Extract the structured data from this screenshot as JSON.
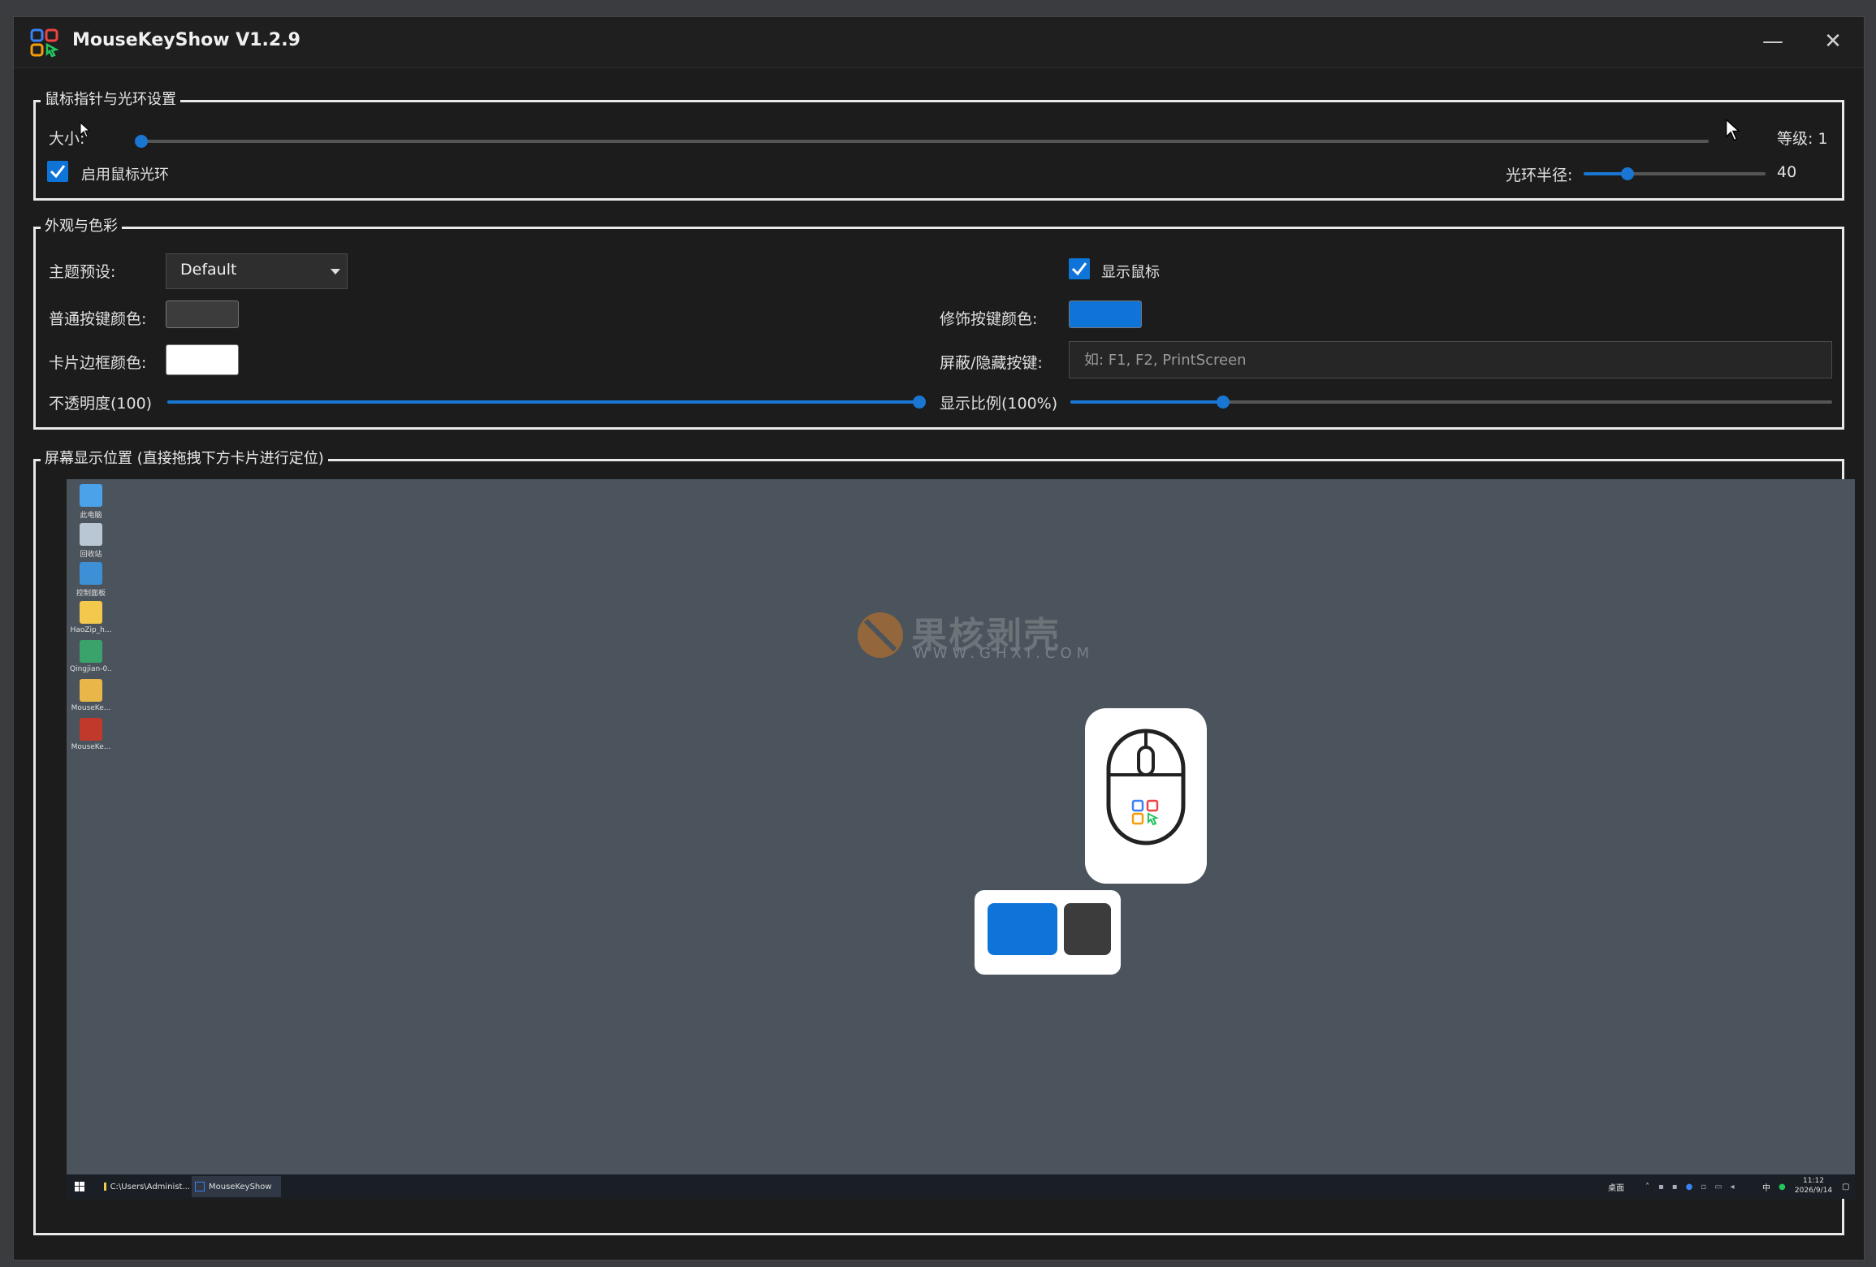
{
  "window": {
    "title": "MouseKeyShow V1.2.9",
    "minimize_glyph": "—",
    "close_glyph": "✕"
  },
  "pointer_group": {
    "title": "鼠标指针与光环设置",
    "size_label": "大小:",
    "size_fraction": 0.0,
    "level_label": "等级: 1",
    "enable_halo_label": "启用鼠标光环",
    "enable_halo_checked": true,
    "halo_radius_label": "光环半径:",
    "halo_radius_value": "40",
    "halo_radius_fraction": 0.24
  },
  "appearance_group": {
    "title": "外观与色彩",
    "theme_label": "主题预设:",
    "theme_value": "Default",
    "show_mouse_label": "显示鼠标",
    "show_mouse_checked": true,
    "normal_key_color_label": "普通按键颜色:",
    "normal_key_color": "#3c3c3c",
    "modifier_key_color_label": "修饰按键颜色:",
    "modifier_key_color": "#0f74d8",
    "card_border_color_label": "卡片边框颜色:",
    "card_border_color": "#ffffff",
    "hide_keys_label": "屏蔽/隐藏按键:",
    "hide_keys_placeholder": "如: F1, F2, PrintScreen",
    "opacity_label": "不透明度(100)",
    "opacity_fraction": 1.0,
    "scale_label": "显示比例(100%)",
    "scale_fraction": 0.2
  },
  "position_group": {
    "title": "屏幕显示位置 (直接拖拽下方卡片进行定位)",
    "desktop_icons": [
      {
        "name": "此电脑",
        "color": "#4aa3e8"
      },
      {
        "name": "回收站",
        "color": "#b9c7d4"
      },
      {
        "name": "控制面板",
        "color": "#3d8fd6"
      },
      {
        "name": "HaoZip_h...",
        "color": "#f2c94c"
      },
      {
        "name": "Qingjian-0...",
        "color": "#3aa36b"
      },
      {
        "name": "MouseKe...",
        "color": "#e9b64a"
      },
      {
        "name": "MouseKe...",
        "color": "#c0392b"
      }
    ],
    "watermark_main": "果核剥壳",
    "watermark_sub": "WWW.GHXI.COM",
    "taskbar": {
      "item1": "C:\\Users\\Administ...",
      "item2": "MouseKeyShow",
      "tray_lang": "桌面",
      "ime": "中",
      "time": "11:12",
      "date": "2026/9/14"
    },
    "preview_normal_key_color": "#3c3c3c",
    "preview_modifier_key_color": "#0f74d8"
  }
}
